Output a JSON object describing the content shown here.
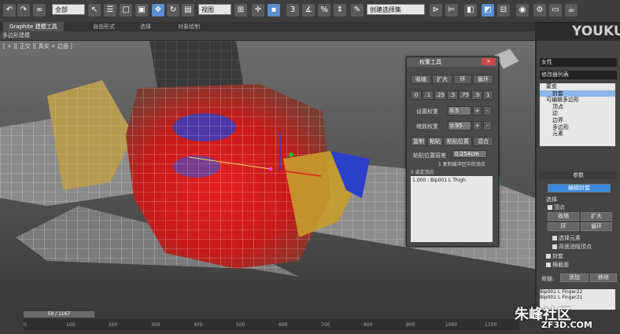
{
  "toolbar": {
    "selection_filter": "全部",
    "view_combo": "视图",
    "named_selection": "创建选择集",
    "icons": [
      "undo-icon",
      "redo-icon",
      "link-icon",
      "unlink-icon",
      "bind-icon",
      "filter-combo",
      "select-icon",
      "select-by-name-icon",
      "rect-select-icon",
      "window-crossing-icon",
      "move-icon",
      "rotate-icon",
      "scale-icon",
      "view-combo",
      "pivot-icon",
      "select-manipulate-icon",
      "snap-icon",
      "angle-snap-icon",
      "percent-snap-icon",
      "spinner-snap-icon",
      "named-selection-combo",
      "mirror-icon",
      "align-icon",
      "layer-icon",
      "curve-editor-icon",
      "schematic-icon",
      "material-editor-icon",
      "render-setup-icon",
      "render-frame-icon",
      "render-icon"
    ]
  },
  "watermark_top": {
    "brand": "YOUKU",
    "sub": "优酷"
  },
  "ribbon": {
    "tabs": [
      "Graphite 建模工具",
      "自由形式",
      "选择",
      "对象绘制"
    ],
    "subtab": "多边形建模"
  },
  "viewport": {
    "label": "[ + ][ 正交 ][ 真实 + 边面 ]"
  },
  "dialog": {
    "title": "权重工具",
    "close": "×",
    "row1": [
      "收缩",
      "扩大",
      "环",
      "循环"
    ],
    "row2": [
      "0",
      ".1",
      ".25",
      ".5",
      ".75",
      ".9",
      "1"
    ],
    "set_weight_label": "设置权重",
    "set_weight_value": "0.5",
    "scale_weight_label": "缩放权重",
    "scale_weight_value": "0.95",
    "plus": "+",
    "minus": "-",
    "row3": [
      "复制",
      "粘贴",
      "粘贴位置",
      "混合"
    ],
    "paste_tol_label": "粘贴位置容差",
    "paste_tol_value": "0.254cm",
    "buffer_note": "1 复制缓冲区中的顶点",
    "sel_count": "5 选定顶点",
    "list_item": "1.000 : Bip001 L Thigh"
  },
  "rpanel": {
    "object_name": "女性",
    "modifier_list": "修改器列表",
    "stack": [
      {
        "label": "蒙皮",
        "selected": false
      },
      {
        "label": "封套",
        "selected": true
      },
      {
        "label": "可编辑多边形",
        "selected": false
      },
      {
        "label": "顶点",
        "selected": false
      },
      {
        "label": "边",
        "selected": false
      },
      {
        "label": "边界",
        "selected": false
      },
      {
        "label": "多边形",
        "selected": false
      },
      {
        "label": "元素",
        "selected": false
      }
    ],
    "params_title": "参数",
    "edit_envelope": "编辑封套",
    "select_label": "选择",
    "vertices_cb": "顶点",
    "shrink": "收缩",
    "grow": "扩大",
    "ring": "环",
    "loop": "循环",
    "select_element": "选择元素",
    "backface_cull": "背面消隐顶点",
    "envelope_cb": "封套",
    "cross_section_cb": "横截面",
    "bones_label": "骨骼:",
    "add_btn": "添加",
    "remove_btn": "移除",
    "bones": [
      "Bip001 L Finger22",
      "Bip001 L Finger21"
    ]
  },
  "timeline": {
    "frame": "59 / 1167",
    "ticks": [
      "0",
      "100",
      "200",
      "300",
      "400",
      "500",
      "600",
      "700",
      "800",
      "900",
      "1000",
      "1100"
    ]
  },
  "watermark_bottom": {
    "brand": "朱峰社区",
    "url": "ZF3D.COM"
  }
}
